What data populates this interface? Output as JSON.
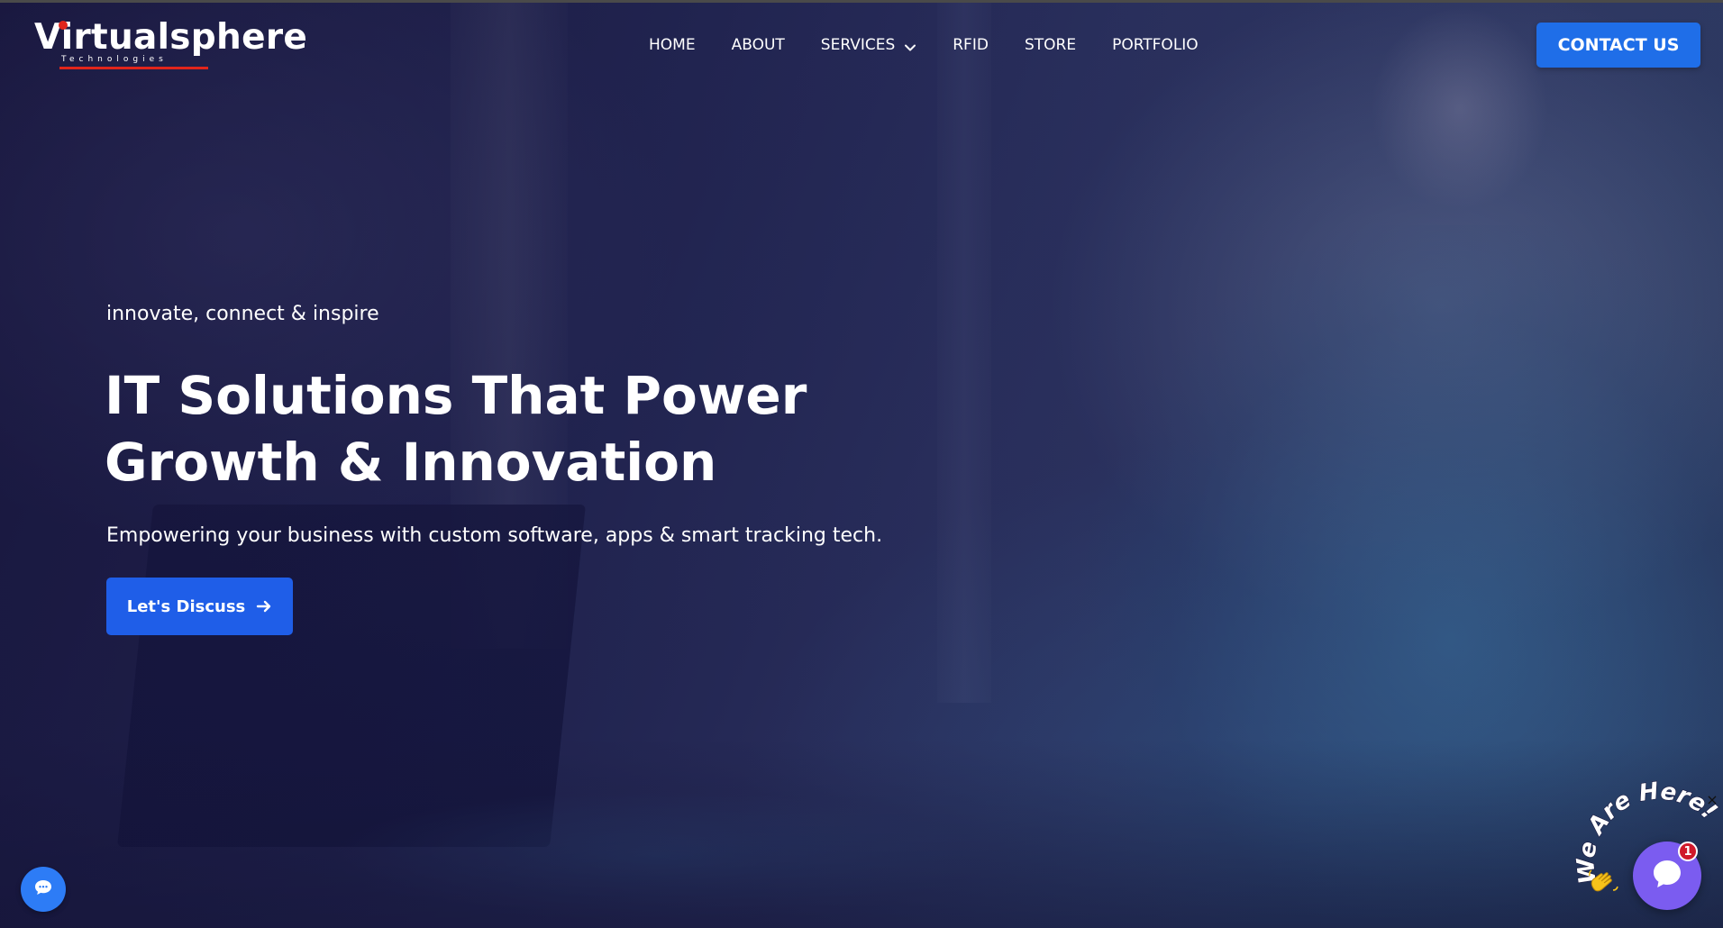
{
  "brand": {
    "name": "Virtualsphere",
    "tagline_small": "Technologies"
  },
  "nav": {
    "items": [
      {
        "label": "HOME",
        "icon": ""
      },
      {
        "label": "ABOUT",
        "icon": ""
      },
      {
        "label": "SERVICES",
        "icon": "chevron-down-icon"
      },
      {
        "label": "RFID",
        "icon": ""
      },
      {
        "label": "STORE",
        "icon": ""
      },
      {
        "label": "PORTFOLIO",
        "icon": ""
      }
    ],
    "contact_label": "CONTACT US"
  },
  "hero": {
    "kicker": "innovate, connect & inspire",
    "title_line1": "IT Solutions That Power",
    "title_line2": "Growth & Innovation",
    "subtitle": "Empowering your business with custom software, apps & smart tracking tech.",
    "cta_label": "Let's Discuss",
    "cta_icon": "arrow-right-icon"
  },
  "widgets": {
    "chat_left_icon": "chat-bubble-icon",
    "we_are_here_text": "We Are Here!",
    "wave_icon": "waving-hand-icon",
    "chat_right_icon": "chat-bubble-icon",
    "unread_count": "1",
    "close_symbol": "×"
  },
  "colors": {
    "accent_blue": "#1f6ee8",
    "brand_red": "#e1251b",
    "chat_purple": "#7b5cf0",
    "badge_red": "#d0192b"
  }
}
